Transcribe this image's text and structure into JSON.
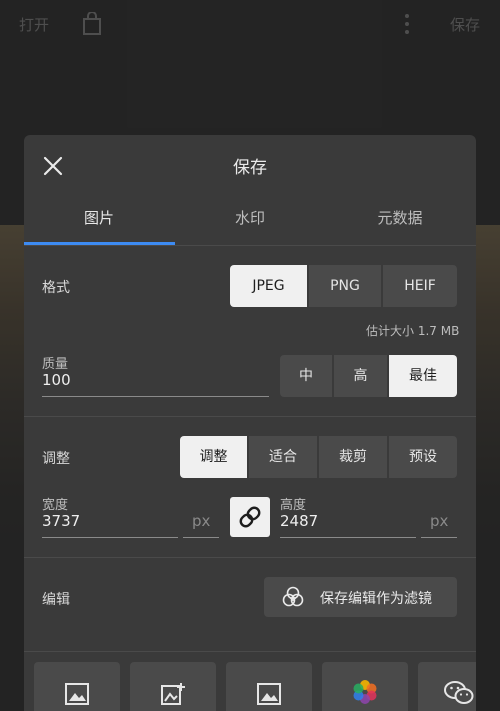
{
  "topbar": {
    "open_label": "打开",
    "save_label": "保存"
  },
  "dialog": {
    "title": "保存",
    "tabs": [
      {
        "label": "图片"
      },
      {
        "label": "水印"
      },
      {
        "label": "元数据"
      }
    ],
    "format": {
      "label": "格式",
      "options": [
        "JPEG",
        "PNG",
        "HEIF"
      ],
      "selected": "JPEG",
      "estimate": "估计大小 1.7 MB"
    },
    "quality": {
      "label": "质量",
      "value": "100",
      "options": [
        "中",
        "高",
        "最佳"
      ],
      "selected": "最佳"
    },
    "resize": {
      "label": "调整",
      "options": [
        "调整",
        "适合",
        "裁剪",
        "预设"
      ],
      "selected": "调整"
    },
    "width": {
      "label": "宽度",
      "value": "3737",
      "unit": "px"
    },
    "height": {
      "label": "高度",
      "value": "2487",
      "unit": "px"
    },
    "edit": {
      "label": "编辑",
      "button_label": "保存编辑作为滤镜"
    },
    "share_targets": [
      {
        "icon": "image-icon"
      },
      {
        "icon": "image-add-icon"
      },
      {
        "icon": "image-icon"
      },
      {
        "icon": "photos-app-icon"
      },
      {
        "icon": "wechat-icon"
      }
    ]
  },
  "colors": {
    "accent": "#3d8bf2",
    "dialog_bg": "#3a3a3a",
    "selected_bg": "#f0f0f0"
  }
}
